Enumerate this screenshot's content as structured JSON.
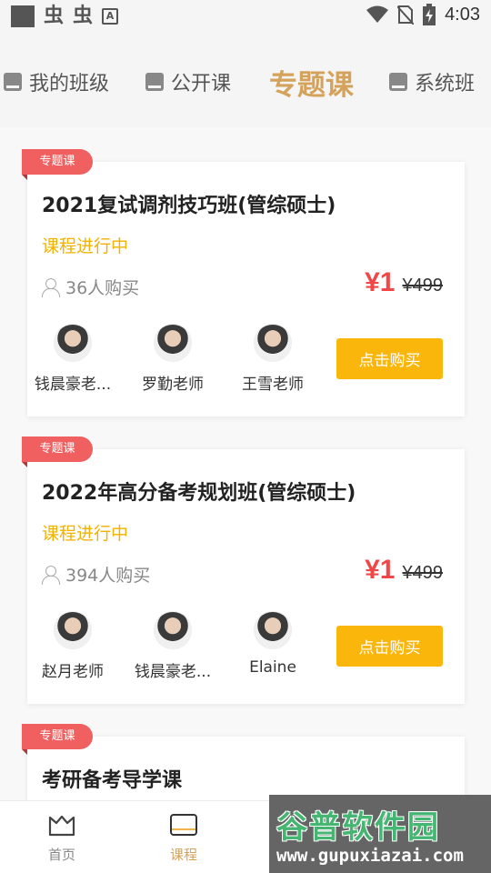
{
  "status_bar": {
    "time": "4:03",
    "a_icon": "A",
    "bug1": "虫",
    "bug2": "虫"
  },
  "top_tabs": [
    {
      "label": "我的班级",
      "icon": "book-icon",
      "active": false
    },
    {
      "label": "公开课",
      "icon": "book-icon",
      "active": false
    },
    {
      "label": "专题课",
      "icon": "",
      "active": true
    },
    {
      "label": "系统班",
      "icon": "book-icon",
      "active": false
    }
  ],
  "courses": [
    {
      "tag": "专题课",
      "title": "2021复试调剂技巧班(管综硕士)",
      "status": "课程进行中",
      "buyers": "36人购买",
      "price": "¥1",
      "original_price": "¥499",
      "teachers": [
        "钱晨豪老...",
        "罗勤老师",
        "王雪老师"
      ],
      "buy_label": "点击购买"
    },
    {
      "tag": "专题课",
      "title": "2022年高分备考规划班(管综硕士)",
      "status": "课程进行中",
      "buyers": "394人购买",
      "price": "¥1",
      "original_price": "¥499",
      "teachers": [
        "赵月老师",
        "钱晨豪老...",
        "Elaine"
      ],
      "buy_label": "点击购买"
    },
    {
      "tag": "专题课",
      "title": "考研备考导学课"
    }
  ],
  "bottom_nav": [
    {
      "label": "首页",
      "icon": "home-crown-icon",
      "active": false
    },
    {
      "label": "课程",
      "icon": "tv-icon",
      "active": true
    }
  ],
  "watermark": {
    "title": "谷普软件园",
    "url": "www.gupuxiazai.com"
  },
  "colors": {
    "accent_gold": "#d4a25b",
    "price_red": "#f04848",
    "button_yellow": "#fbb60b",
    "status_yellow": "#f3b100",
    "ribbon_red": "#f06060"
  }
}
